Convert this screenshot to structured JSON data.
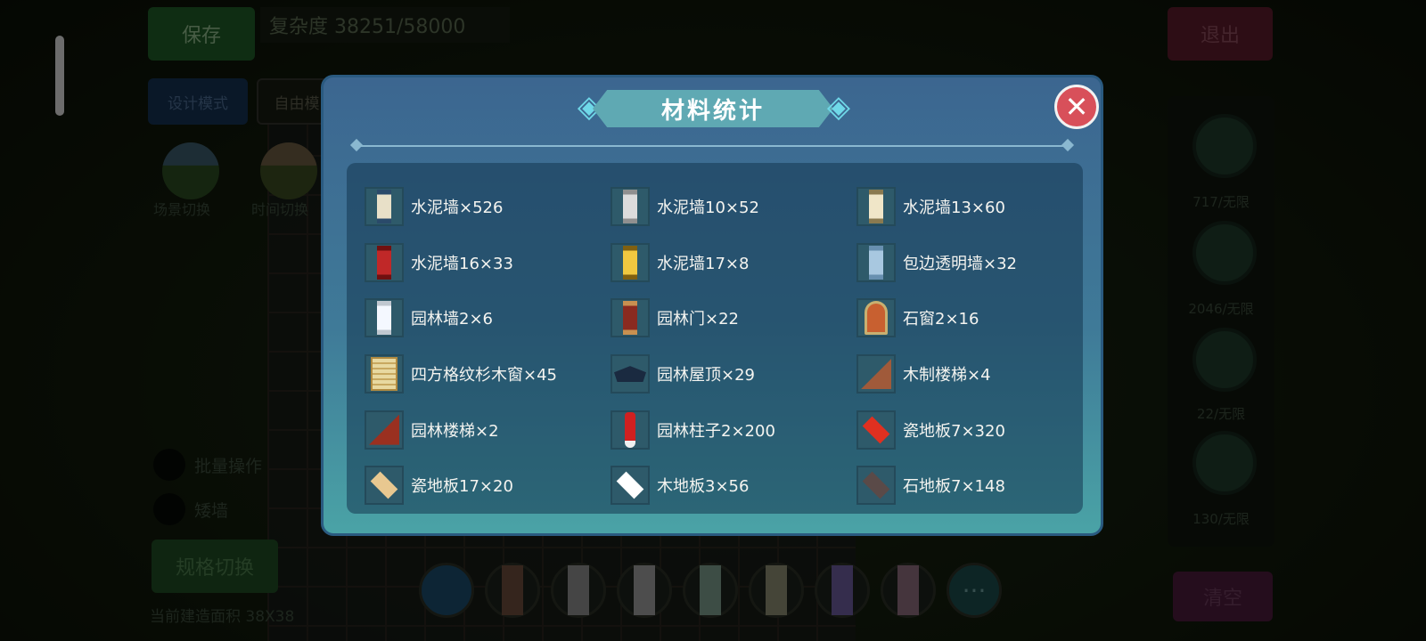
{
  "topbar": {
    "save_label": "保存",
    "complexity": "复杂度 38251/58000",
    "exit_label": "退出"
  },
  "left_panel": {
    "design_mode": "设计模式",
    "free_mode": "自由模",
    "scene_switch": "场景切换",
    "time_switch": "时间切换",
    "batch_op": "批量操作",
    "short_wall": "矮墙",
    "spec_switch": "规格切换",
    "build_area": "当前建造面积 38X38"
  },
  "right_panel": {
    "counts": [
      "717/无限",
      "2046/无限",
      "22/无限",
      "130/无限"
    ],
    "clear_label": "清空"
  },
  "modal": {
    "title": "材料统计",
    "close_icon": "close-icon",
    "items": [
      {
        "label": "水泥墙×526",
        "icon": "wall-blue-icon",
        "color": "#e8e0c8",
        "accent": "#2a4a6a"
      },
      {
        "label": "水泥墙10×52",
        "icon": "wall-grey-icon",
        "color": "#dcdcdc",
        "accent": "#909090"
      },
      {
        "label": "水泥墙13×60",
        "icon": "wall-cream-icon",
        "color": "#f0e6c8",
        "accent": "#8a7a50"
      },
      {
        "label": "水泥墙16×33",
        "icon": "wall-red-icon",
        "color": "#c02828",
        "accent": "#701010"
      },
      {
        "label": "水泥墙17×8",
        "icon": "wall-yellow-icon",
        "color": "#f0c840",
        "accent": "#806010"
      },
      {
        "label": "包边透明墙×32",
        "icon": "wall-glass-icon",
        "color": "#a8c8e0",
        "accent": "#6890b0"
      },
      {
        "label": "园林墙2×6",
        "icon": "wall-white-icon",
        "color": "#f4f8ff",
        "accent": "#c0c8d0"
      },
      {
        "label": "园林门×22",
        "icon": "door-icon",
        "color": "#8a2a20",
        "accent": "#c89050"
      },
      {
        "label": "石窗2×16",
        "icon": "arch-window-icon",
        "color": "#c86030",
        "accent": "#e8c050"
      },
      {
        "label": "四方格纹杉木窗×45",
        "icon": "lattice-window-icon",
        "color": "#e8d8a0",
        "accent": "#b08a40"
      },
      {
        "label": "园林屋顶×29",
        "icon": "roof-icon",
        "color": "#1a2a40",
        "accent": "#4a6a90"
      },
      {
        "label": "木制楼梯×4",
        "icon": "wood-stair-icon",
        "color": "#a05a3a",
        "accent": "#603020"
      },
      {
        "label": "园林楼梯×2",
        "icon": "garden-stair-icon",
        "color": "#9a3020",
        "accent": "#502010"
      },
      {
        "label": "园林柱子2×200",
        "icon": "pillar-icon",
        "color": "#d02020",
        "accent": "#f0f0f0"
      },
      {
        "label": "瓷地板7×320",
        "icon": "red-tile-icon",
        "color": "#e03020",
        "accent": "#a01810"
      },
      {
        "label": "瓷地板17×20",
        "icon": "pattern-tile-icon",
        "color": "#e8c890",
        "accent": "#8a5a20"
      },
      {
        "label": "木地板3×56",
        "icon": "white-tile-icon",
        "color": "#ffffff",
        "accent": "#d0d0d0"
      },
      {
        "label": "石地板7×148",
        "icon": "stone-tile-icon",
        "color": "#5a4a48",
        "accent": "#3a3030"
      }
    ]
  },
  "bottom_bar": {
    "more_label": "···"
  }
}
